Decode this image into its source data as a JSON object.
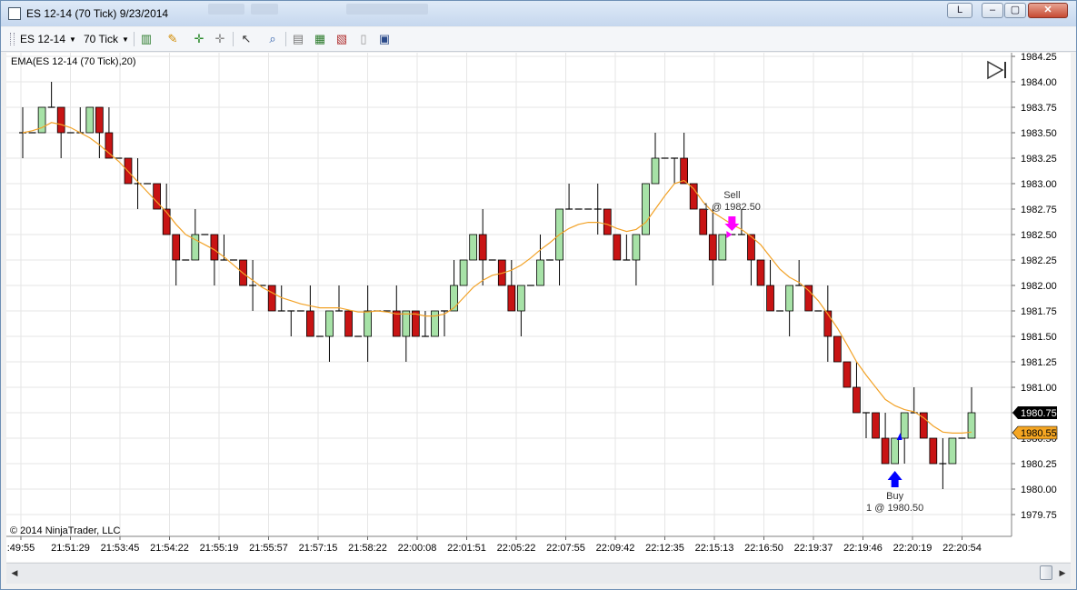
{
  "window": {
    "title": "ES 12-14 (70 Tick)  9/23/2014",
    "buttons": {
      "layout": "L",
      "minimize": "▭",
      "maximize": "□",
      "close": "✕"
    }
  },
  "toolbar": {
    "instrument": "ES 12-14",
    "interval": "70 Tick",
    "icons": [
      "bar-type-icon",
      "drawing-pencil-icon",
      "crosshair-icon",
      "global-crosshair-icon",
      "pointer-icon",
      "zoom-icon",
      "data-box-icon",
      "strategies-icon",
      "indicators-icon",
      "properties-icon",
      "chart-style-icon"
    ]
  },
  "chart": {
    "indicator_label": "EMA(ES 12-14 (70 Tick),20)",
    "copyright": "© 2014 NinjaTrader, LLC",
    "price_ticks": [
      "1984.25",
      "1984.00",
      "1983.75",
      "1983.50",
      "1983.25",
      "1983.00",
      "1982.75",
      "1982.50",
      "1982.25",
      "1982.00",
      "1981.75",
      "1981.50",
      "1981.25",
      "1981.00",
      "1980.75",
      "1980.50",
      "1980.25",
      "1980.00",
      "1979.75"
    ],
    "time_ticks": [
      ":49:55",
      "21:51:29",
      "21:53:45",
      "21:54:22",
      "21:55:19",
      "21:55:57",
      "21:57:15",
      "21:58:22",
      "22:00:08",
      "22:01:51",
      "22:05:22",
      "22:07:55",
      "22:09:42",
      "22:12:35",
      "22:15:13",
      "22:16:50",
      "22:19:37",
      "22:19:46",
      "22:20:19",
      "22:20:54"
    ],
    "last_price_label": "1980.75",
    "ema_price_label": "1980.55",
    "sell_label": "Sell",
    "sell_detail": "1 @ 1982.50",
    "buy_label": "Buy",
    "buy_detail": "1 @ 1980.50",
    "colors": {
      "up": "#a7e2a7",
      "down": "#c81414",
      "ema": "#f2a227",
      "sell": "#ff00ff",
      "buy": "#0000ff",
      "last_bg": "#000000",
      "ema_bg": "#f5a623"
    }
  },
  "chart_data": {
    "type": "candlestick",
    "series": [
      {
        "name": "ES 12-14 (70 Tick)",
        "close": [
          1983.5,
          1983.5,
          1983.75,
          1983.75,
          1983.5,
          1983.5,
          1983.5,
          1983.75,
          1983.5,
          1983.25,
          1983.25,
          1983.0,
          1983.0,
          1983.0,
          1982.75,
          1982.5,
          1982.25,
          1982.25,
          1982.5,
          1982.5,
          1982.25,
          1982.25,
          1982.25,
          1982.0,
          1982.0,
          1982.0,
          1981.75,
          1981.75,
          1981.75,
          1981.75,
          1981.5,
          1981.5,
          1981.75,
          1981.75,
          1981.5,
          1981.5,
          1981.75,
          1981.75,
          1981.75,
          1981.5,
          1981.75,
          1981.5,
          1981.5,
          1981.75,
          1981.75,
          1982.0,
          1982.25,
          1982.5,
          1982.25,
          1982.25,
          1982.0,
          1981.75,
          1982.0,
          1982.0,
          1982.25,
          1982.25,
          1982.75,
          1982.75,
          1982.75,
          1982.75,
          1982.75,
          1982.5,
          1982.25,
          1982.25,
          1982.5,
          1983.0,
          1983.25,
          1983.25,
          1983.25,
          1983.0,
          1982.75,
          1982.5,
          1982.25,
          1982.5,
          1982.5,
          1982.5,
          1982.25,
          1982.0,
          1981.75,
          1981.75,
          1982.0,
          1982.0,
          1981.75,
          1981.75,
          1981.5,
          1981.25,
          1981.0,
          1980.75,
          1980.75,
          1980.5,
          1980.25,
          1980.5,
          1980.75,
          1980.75,
          1980.5,
          1980.25,
          1980.25,
          1980.5,
          1980.5,
          1980.75
        ]
      },
      {
        "name": "EMA(ES 12-14 (70 Tick),20)",
        "values": [
          1983.5,
          1983.52,
          1983.55,
          1983.6,
          1983.58,
          1983.55,
          1983.5,
          1983.45,
          1983.38,
          1983.3,
          1983.22,
          1983.12,
          1983.02,
          1982.92,
          1982.82,
          1982.72,
          1982.6,
          1982.5,
          1982.45,
          1982.4,
          1982.35,
          1982.28,
          1982.2,
          1982.12,
          1982.05,
          1981.98,
          1981.93,
          1981.88,
          1981.85,
          1981.82,
          1981.8,
          1981.78,
          1981.78,
          1981.78,
          1981.76,
          1981.74,
          1981.74,
          1981.75,
          1981.74,
          1981.72,
          1981.72,
          1981.72,
          1981.7,
          1981.7,
          1981.72,
          1981.78,
          1981.88,
          1981.98,
          1982.05,
          1982.1,
          1982.12,
          1982.15,
          1982.2,
          1982.27,
          1982.35,
          1982.42,
          1982.5,
          1982.56,
          1982.6,
          1982.62,
          1982.62,
          1982.6,
          1982.56,
          1982.53,
          1982.55,
          1982.62,
          1982.75,
          1982.88,
          1983.0,
          1983.03,
          1982.95,
          1982.82,
          1982.72,
          1982.66,
          1982.6,
          1982.55,
          1982.48,
          1982.4,
          1982.28,
          1982.16,
          1982.08,
          1982.03,
          1981.95,
          1981.85,
          1981.72,
          1981.58,
          1981.42,
          1981.25,
          1981.12,
          1981.0,
          1980.88,
          1980.82,
          1980.78,
          1980.76,
          1980.7,
          1980.62,
          1980.56,
          1980.55,
          1980.55,
          1980.56
        ]
      }
    ],
    "y_axis": {
      "min": 1979.75,
      "max": 1984.25,
      "tick_step": 0.25
    },
    "x_axis": {
      "labels": [
        ":49:55",
        "21:51:29",
        "21:53:45",
        "21:54:22",
        "21:55:19",
        "21:55:57",
        "21:57:15",
        "21:58:22",
        "22:00:08",
        "22:01:51",
        "22:05:22",
        "22:07:55",
        "22:09:42",
        "22:12:35",
        "22:15:13",
        "22:16:50",
        "22:19:37",
        "22:19:46",
        "22:20:19",
        "22:20:54"
      ]
    },
    "markers": [
      {
        "type": "sell",
        "text": "Sell",
        "detail": "1 @ 1982.50",
        "price": 1982.5
      },
      {
        "type": "buy",
        "text": "Buy",
        "detail": "1 @ 1980.50",
        "price": 1980.5
      }
    ],
    "grid": true
  }
}
